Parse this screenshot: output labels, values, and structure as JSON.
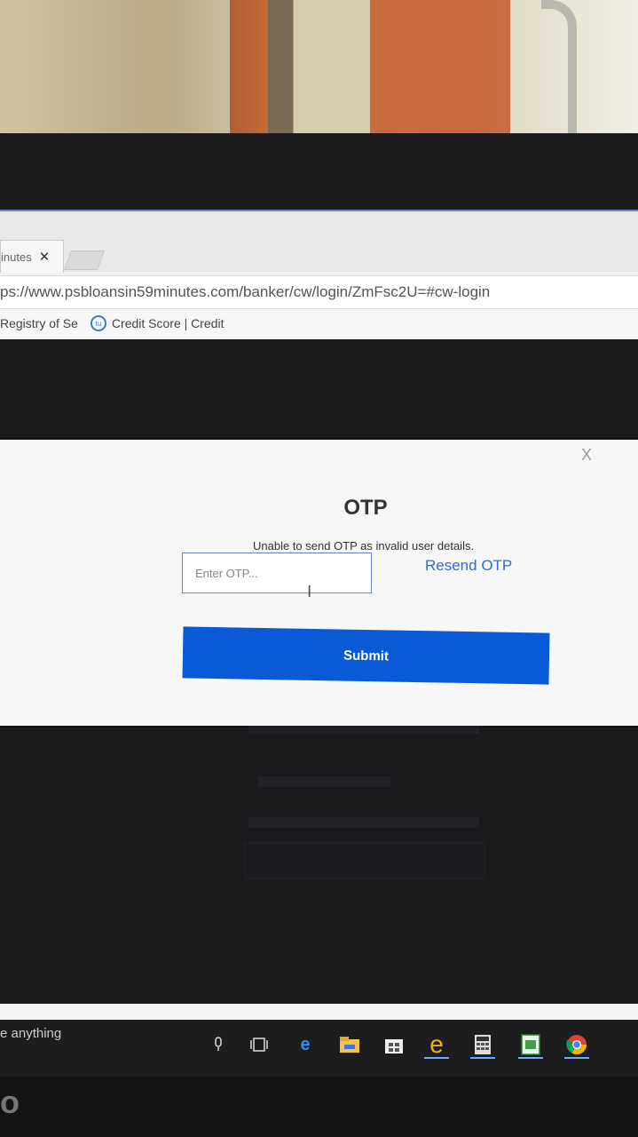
{
  "browser": {
    "tab_title": "inutes",
    "tab_close": "✕",
    "url": "ps://www.psbloansin59minutes.com/banker/cw/login/ZmFsc2U=#cw-login",
    "bookmarks": [
      "Registry of Se",
      "Credit Score | Credit"
    ],
    "bookmark_icon_text": "tu"
  },
  "modal": {
    "close_label": "X",
    "title": "OTP",
    "error_message": "Unable to send OTP as invalid user details.",
    "otp_placeholder": "Enter OTP...",
    "otp_value": "",
    "resend_label": "Resend OTP",
    "submit_label": "Submit"
  },
  "taskbar": {
    "search_text": "e anything",
    "icons": [
      "microphone-icon",
      "task-view-icon",
      "edge-icon",
      "file-explorer-icon",
      "store-icon",
      "internet-explorer-icon",
      "calculator-icon",
      "spreadsheet-icon",
      "chrome-icon"
    ]
  },
  "brand_text": "o",
  "colors": {
    "accent": "#0a5ad8",
    "link": "#2f6bd8",
    "input_border": "#6a84c9"
  }
}
